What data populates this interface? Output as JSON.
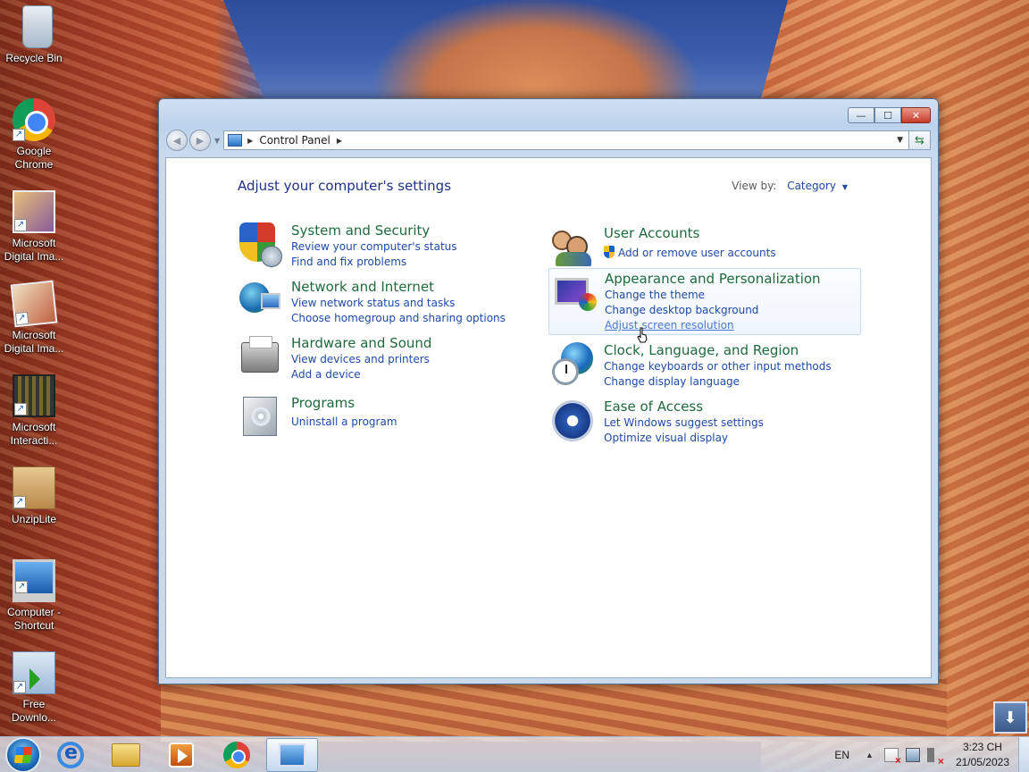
{
  "desktop": {
    "icons": [
      {
        "label": "Recycle Bin",
        "icon": "recycle-bin-icon"
      },
      {
        "label": "Google Chrome",
        "icon": "chrome-icon"
      },
      {
        "label": "Microsoft Digital Ima...",
        "icon": "digital-image-icon"
      },
      {
        "label": "Microsoft Digital Ima...",
        "icon": "digital-image-editor-icon"
      },
      {
        "label": "Microsoft Interacti...",
        "icon": "interactive-media-icon"
      },
      {
        "label": "UnzipLite",
        "icon": "unziplite-icon"
      },
      {
        "label": "Computer - Shortcut",
        "icon": "computer-icon"
      },
      {
        "label": "Free Downlo...",
        "icon": "free-download-manager-icon"
      }
    ]
  },
  "window": {
    "controls": {
      "minimize": "—",
      "maximize": "☐",
      "close": "✕"
    },
    "breadcrumb": {
      "root": "Control Panel"
    },
    "heading": "Adjust your computer's settings",
    "view_by": {
      "label": "View by:",
      "value": "Category"
    },
    "categories_left": [
      {
        "title": "System and Security",
        "links": [
          "Review your computer's status",
          "Find and fix problems"
        ]
      },
      {
        "title": "Network and Internet",
        "links": [
          "View network status and tasks",
          "Choose homegroup and sharing options"
        ]
      },
      {
        "title": "Hardware and Sound",
        "links": [
          "View devices and printers",
          "Add a device"
        ]
      },
      {
        "title": "Programs",
        "links": [
          "Uninstall a program"
        ]
      }
    ],
    "categories_right": [
      {
        "title": "User Accounts",
        "links": [
          "Add or remove user accounts"
        ]
      },
      {
        "title": "Appearance and Personalization",
        "links": [
          "Change the theme",
          "Change desktop background",
          "Adjust screen resolution"
        ]
      },
      {
        "title": "Clock, Language, and Region",
        "links": [
          "Change keyboards or other input methods",
          "Change display language"
        ]
      },
      {
        "title": "Ease of Access",
        "links": [
          "Let Windows suggest settings",
          "Optimize visual display"
        ]
      }
    ]
  },
  "taskbar": {
    "language": "EN",
    "time": "3:23 CH",
    "date": "21/05/2023"
  },
  "colors": {
    "category_title": "#1e6a3c",
    "link": "#1e4aa8",
    "heading": "#1e3287"
  }
}
